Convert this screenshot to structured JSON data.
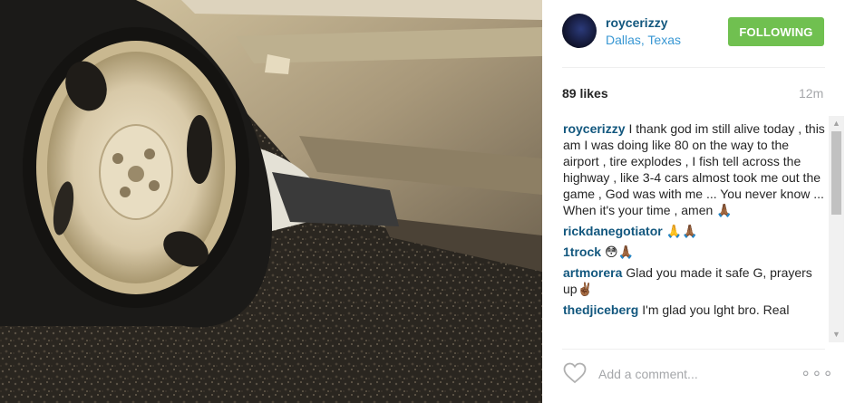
{
  "post": {
    "username": "roycerizzy",
    "location": "Dallas, Texas",
    "follow_label": "FOLLOWING",
    "likes": "89 likes",
    "time": "12m",
    "comment_placeholder": "Add a comment...",
    "more_label": "∘∘∘"
  },
  "comments": [
    {
      "author": "roycerizzy",
      "text": "I thank god im still alive today , this am I was doing like 80 on the way to the airport , tire explodes , I fish tell across the highway , like 3-4 cars almost took me out the game , God was with me ... You never know ... When it's your time , amen 🙏🏾"
    },
    {
      "author": "rickdanegotiator",
      "text": "🙏🙏🏾"
    },
    {
      "author": "1trock",
      "text": "😳🙏🏾"
    },
    {
      "author": "artmorera",
      "text": "Glad you made it safe G, prayers up✌🏾"
    },
    {
      "author": "thedjiceberg",
      "text": "I'm glad you lght bro. Real"
    }
  ],
  "colors": {
    "username": "#12577e",
    "location": "#3897d3",
    "follow_button": "#70c050",
    "muted": "#a5a7aa"
  },
  "icons": {
    "heart": "heart-icon",
    "more": "more-icon",
    "scroll_up": "scroll-up-icon",
    "scroll_down": "scroll-down-icon"
  }
}
